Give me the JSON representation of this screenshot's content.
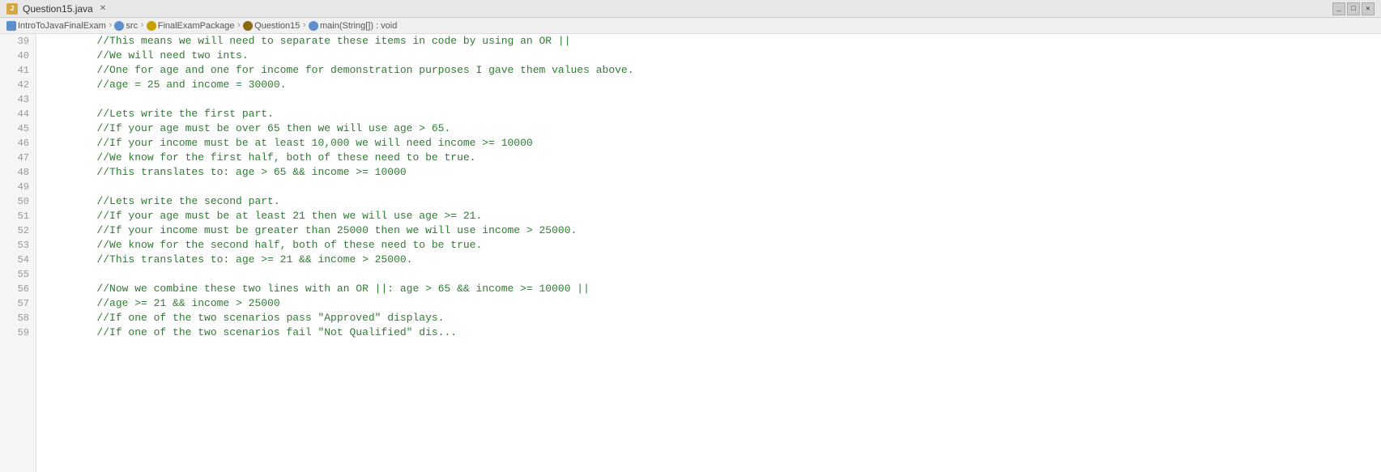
{
  "window": {
    "title": "Question15.java",
    "close_symbol": "✕"
  },
  "breadcrumb": {
    "items": [
      {
        "label": "IntroToJavaFinalExam",
        "type": "project"
      },
      {
        "label": "src",
        "type": "src"
      },
      {
        "label": "FinalExamPackage",
        "type": "package"
      },
      {
        "label": "Question15",
        "type": "class"
      },
      {
        "label": "main(String[]) : void",
        "type": "method"
      }
    ]
  },
  "colors": {
    "comment": "#2e7d32",
    "line_number": "#999999",
    "background": "#ffffff",
    "gutter": "#f5f5f5"
  },
  "lines": [
    {
      "num": "39",
      "text": "        //This means we will need to separate these items in code by using an OR ||"
    },
    {
      "num": "40",
      "text": "        //We will need two ints."
    },
    {
      "num": "41",
      "text": "        //One for age and one for income for demonstration purposes I gave them values above."
    },
    {
      "num": "42",
      "text": "        //age = 25 and income = 30000."
    },
    {
      "num": "43",
      "text": ""
    },
    {
      "num": "44",
      "text": "        //Lets write the first part."
    },
    {
      "num": "45",
      "text": "        //If your age must be over 65 then we will use age > 65."
    },
    {
      "num": "46",
      "text": "        //If your income must be at least 10,000 we will need income >= 10000"
    },
    {
      "num": "47",
      "text": "        //We know for the first half, both of these need to be true."
    },
    {
      "num": "48",
      "text": "        //This translates to: age > 65 && income >= 10000"
    },
    {
      "num": "49",
      "text": ""
    },
    {
      "num": "50",
      "text": "        //Lets write the second part."
    },
    {
      "num": "51",
      "text": "        //If your age must be at least 21 then we will use age >= 21."
    },
    {
      "num": "52",
      "text": "        //If your income must be greater than 25000 then we will use income > 25000."
    },
    {
      "num": "53",
      "text": "        //We know for the second half, both of these need to be true."
    },
    {
      "num": "54",
      "text": "        //This translates to: age >= 21 && income > 25000."
    },
    {
      "num": "55",
      "text": ""
    },
    {
      "num": "56",
      "text": "        //Now we combine these two lines with an OR ||: age > 65 && income >= 10000 ||"
    },
    {
      "num": "57",
      "text": "        //age >= 21 && income > 25000"
    },
    {
      "num": "58",
      "text": "        //If one of the two scenarios pass \"Approved\" displays."
    },
    {
      "num": "59",
      "text": "        //If one of the two scenarios fail \"Not Qualified\" dis..."
    }
  ]
}
